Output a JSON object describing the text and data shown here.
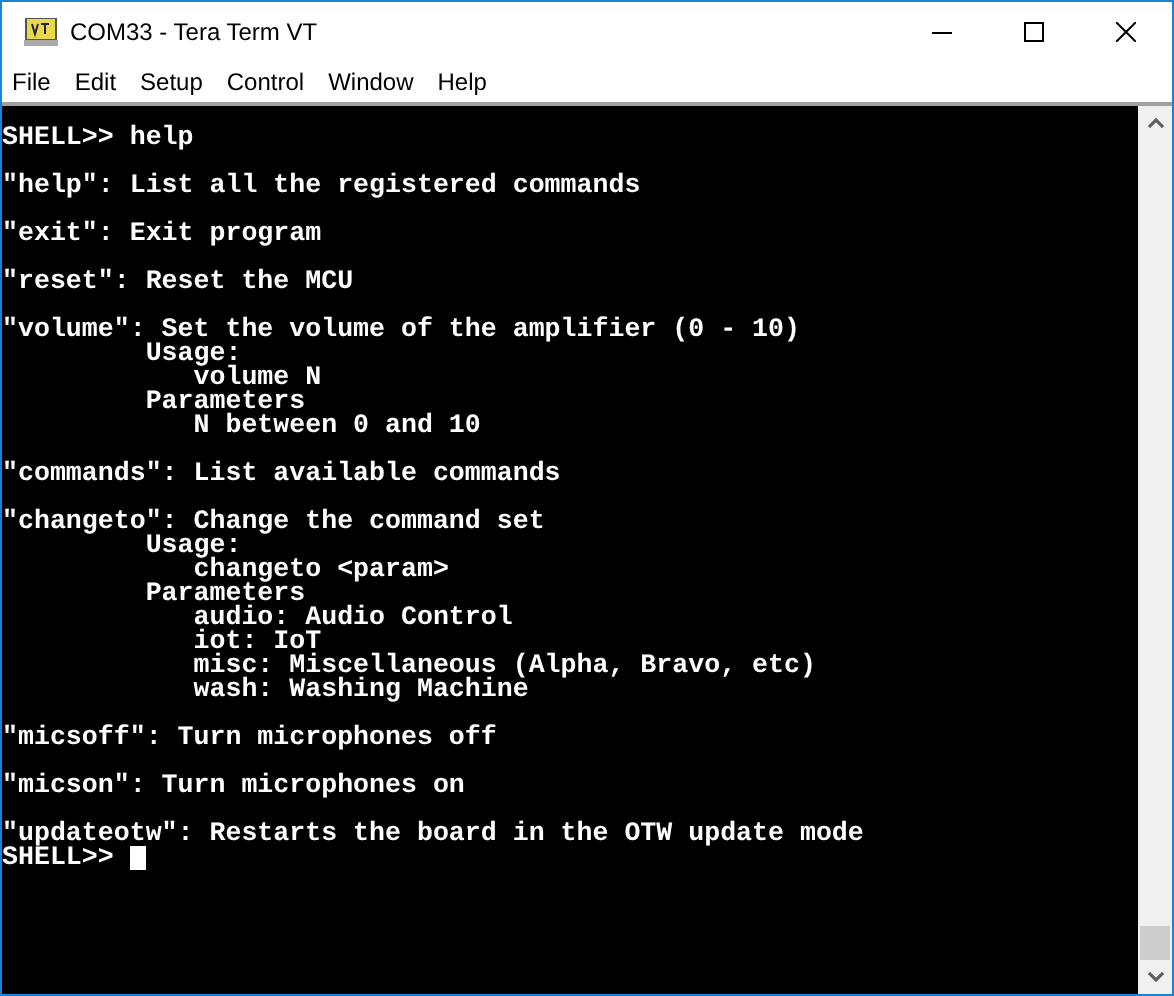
{
  "window": {
    "title": "COM33 - Tera Term VT"
  },
  "menu": [
    "File",
    "Edit",
    "Setup",
    "Control",
    "Window",
    "Help"
  ],
  "terminal": {
    "blocks": [
      [
        "SHELL>> help"
      ],
      [
        "\"help\": List all the registered commands"
      ],
      [
        "\"exit\": Exit program"
      ],
      [
        "\"reset\": Reset the MCU"
      ],
      [
        "\"volume\": Set the volume of the amplifier (0 - 10)",
        "         Usage:",
        "            volume N",
        "         Parameters",
        "            N between 0 and 10"
      ],
      [
        "\"commands\": List available commands"
      ],
      [
        "\"changeto\": Change the command set",
        "         Usage:",
        "            changeto <param>",
        "         Parameters",
        "            audio: Audio Control",
        "            iot: IoT",
        "            misc: Miscellaneous (Alpha, Bravo, etc)",
        "            wash: Washing Machine"
      ],
      [
        "\"micsoff\": Turn microphones off"
      ],
      [
        "\"micson\": Turn microphones on"
      ],
      [
        "\"updateotw\": Restarts the board in the OTW update mode",
        "SHELL>> "
      ]
    ],
    "cursor_visible": true
  }
}
